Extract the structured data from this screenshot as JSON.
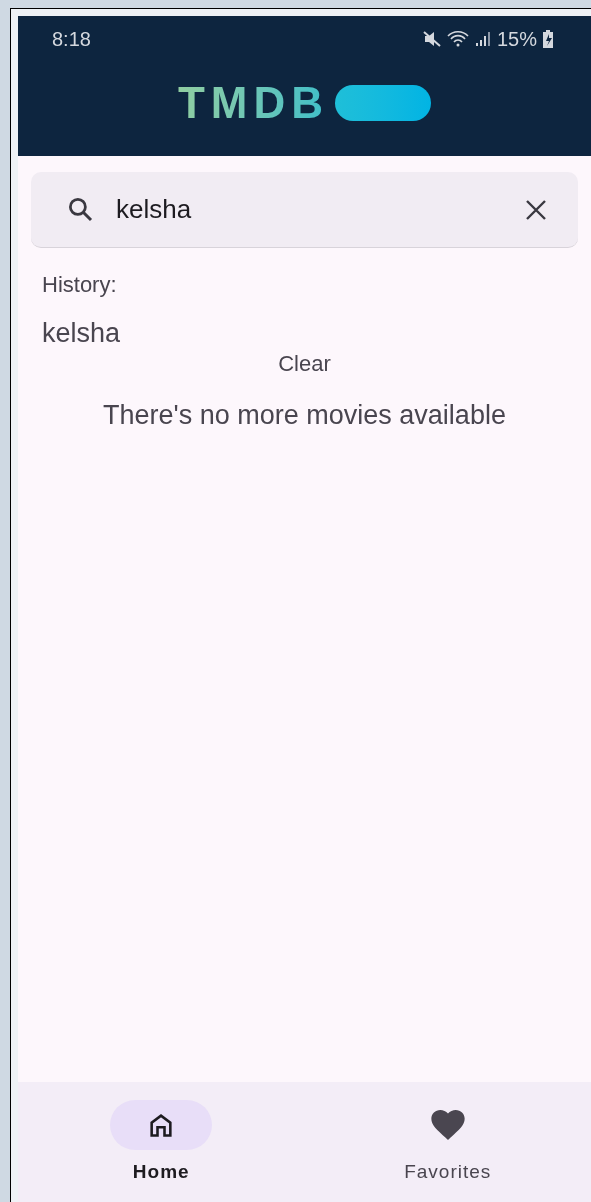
{
  "status_bar": {
    "time": "8:18",
    "battery": "15%"
  },
  "header": {
    "logo": "TMDB"
  },
  "search": {
    "value": "kelsha"
  },
  "history": {
    "label": "History:",
    "items": [
      "kelsha"
    ],
    "clear": "Clear"
  },
  "message": "There's no more movies available",
  "nav": [
    {
      "label": "Home",
      "selected": true
    },
    {
      "label": "Favorites",
      "selected": false
    }
  ]
}
